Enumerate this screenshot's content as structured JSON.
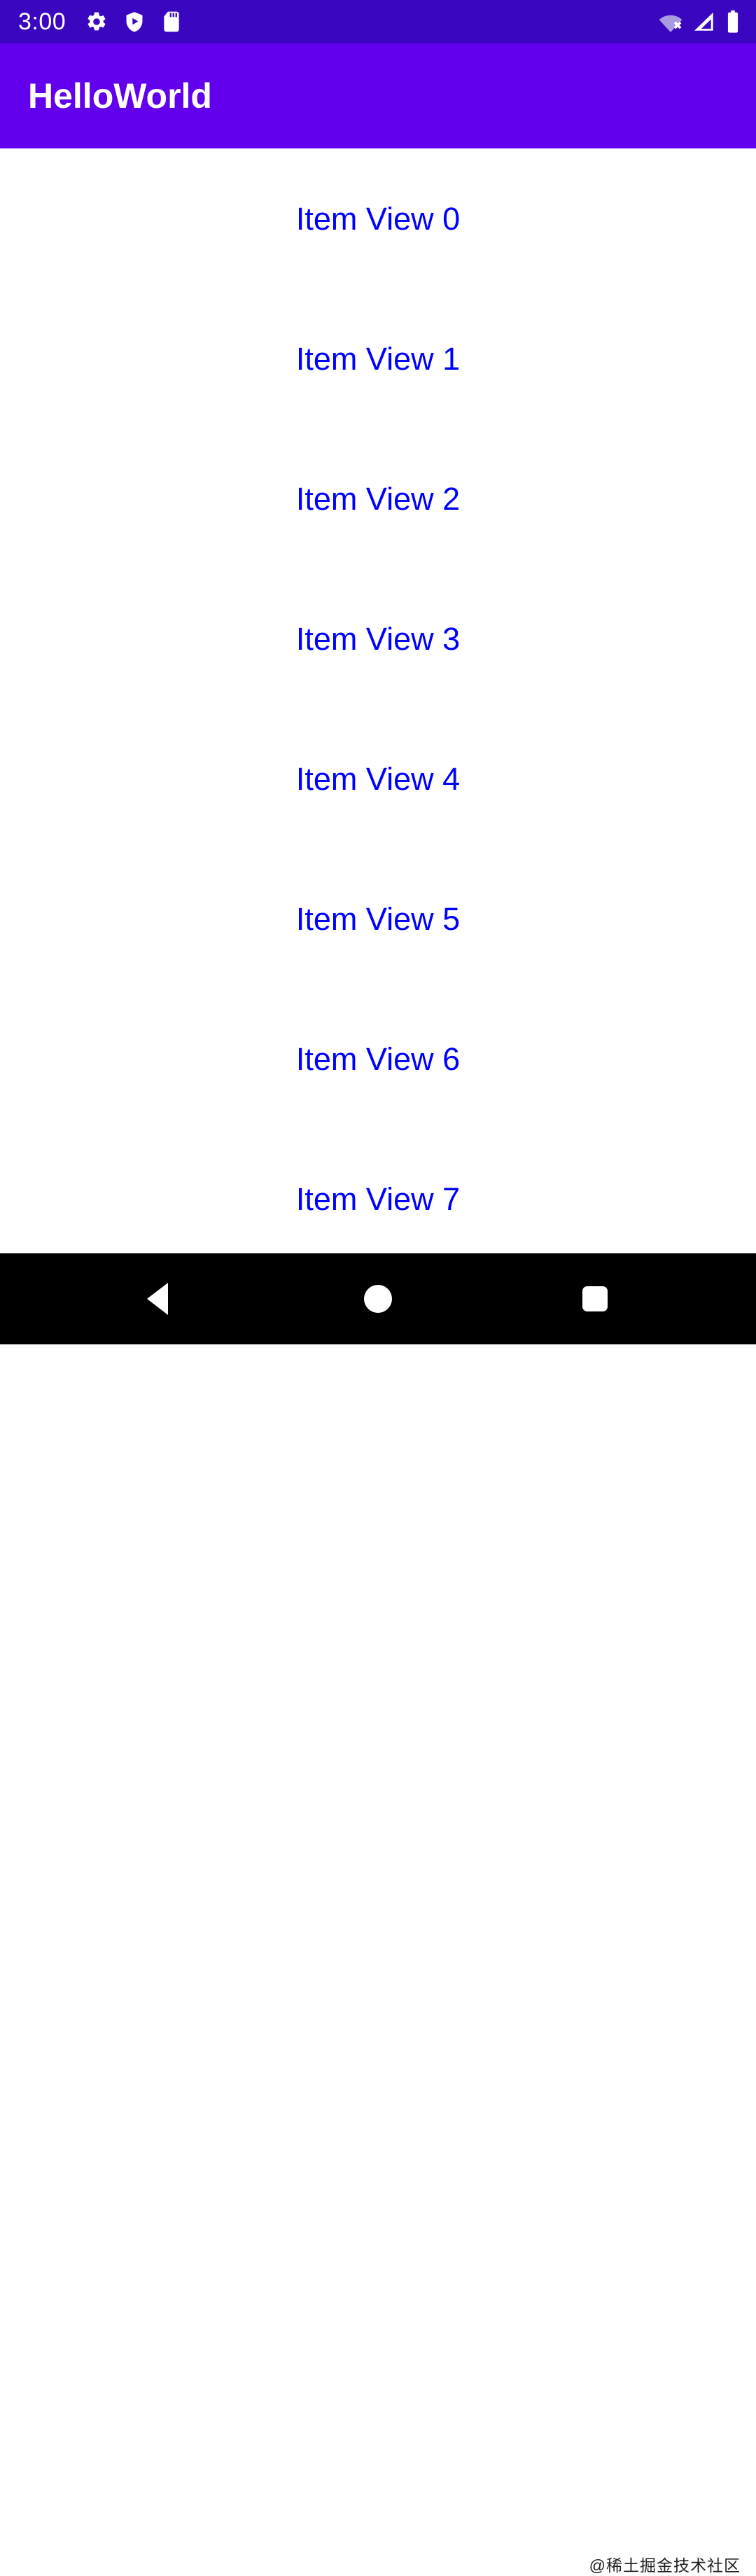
{
  "status_bar": {
    "background_color": "#3A06C0",
    "clock": "3:00",
    "left_icons": [
      {
        "name": "settings-gear-icon",
        "glyph": "gear"
      },
      {
        "name": "play-protect-shield-icon",
        "glyph": "shield-play"
      },
      {
        "name": "sd-card-icon",
        "glyph": "sd-card"
      }
    ],
    "right_icons": [
      {
        "name": "wifi-disconnected-icon",
        "glyph": "wifi-x"
      },
      {
        "name": "cellular-signal-icon",
        "glyph": "signal-triangle"
      },
      {
        "name": "battery-full-icon",
        "glyph": "battery"
      }
    ]
  },
  "app_bar": {
    "title": "HelloWorld",
    "background_color": "#6200EE",
    "text_color": "#FFFFFF"
  },
  "content": {
    "background_color": "#FFFFFF",
    "item_text_color": "#0000FF",
    "items": [
      {
        "label": "Item View 0"
      },
      {
        "label": "Item View 1"
      },
      {
        "label": "Item View 2"
      },
      {
        "label": "Item View 3"
      },
      {
        "label": "Item View 4"
      },
      {
        "label": "Item View 5"
      },
      {
        "label": "Item View 6"
      },
      {
        "label": "Item View 7"
      }
    ]
  },
  "nav_bar": {
    "background_color": "#000000",
    "buttons": [
      {
        "name": "back-button",
        "glyph": "triangle-left"
      },
      {
        "name": "home-button",
        "glyph": "circle"
      },
      {
        "name": "recents-button",
        "glyph": "rounded-square"
      }
    ],
    "watermark": "@稀土掘金技术社区"
  }
}
